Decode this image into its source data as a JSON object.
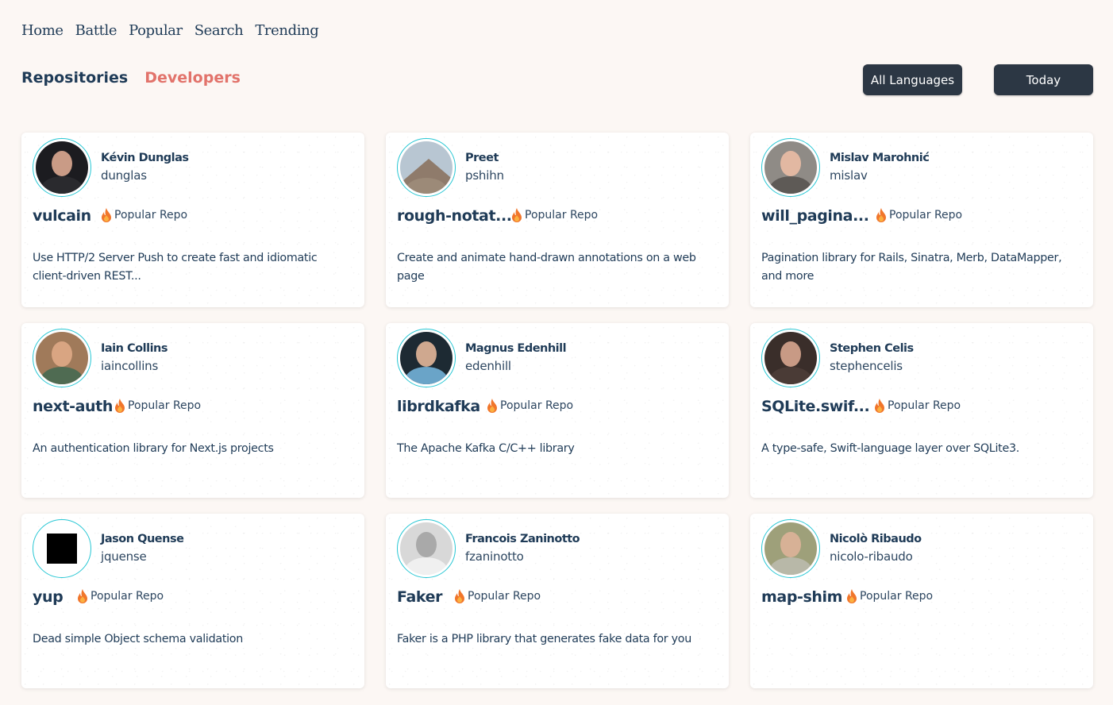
{
  "nav": {
    "home": "Home",
    "battle": "Battle",
    "popular": "Popular",
    "search": "Search",
    "trending": "Trending"
  },
  "tabs": {
    "repositories": "Repositories",
    "developers": "Developers"
  },
  "filters": {
    "language": "All Languages",
    "period": "Today"
  },
  "badge_label": "Popular Repo",
  "colors": {
    "background": "#fcf7f4",
    "text": "#1f3b57",
    "active_tab": "#e2736b",
    "button": "#2c3744",
    "avatar_ring": "#28c7d4",
    "fire": "#f1762b"
  },
  "developers": [
    {
      "name": "Kévin Dunglas",
      "username": "dunglas",
      "repo": "vulcain",
      "description": "Use HTTP/2 Server Push to create fast and idiomatic client-driven REST..."
    },
    {
      "name": "Preet",
      "username": "pshihn",
      "repo": "rough-notat...",
      "description": "Create and animate hand-drawn annotations on a web page"
    },
    {
      "name": "Mislav Marohnić",
      "username": "mislav",
      "repo": "will_pagina...",
      "description": "Pagination library for Rails, Sinatra, Merb, DataMapper, and more"
    },
    {
      "name": "Iain Collins",
      "username": "iaincollins",
      "repo": "next-auth",
      "description": "An authentication library for Next.js projects"
    },
    {
      "name": "Magnus Edenhill",
      "username": "edenhill",
      "repo": "librdkafka",
      "description": "The Apache Kafka C/C++ library"
    },
    {
      "name": "Stephen Celis",
      "username": "stephencelis",
      "repo": "SQLite.swif...",
      "description": "A type-safe, Swift-language layer over SQLite3."
    },
    {
      "name": "Jason Quense",
      "username": "jquense",
      "repo": "yup",
      "description": "Dead simple Object schema validation"
    },
    {
      "name": "Francois Zaninotto",
      "username": "fzaninotto",
      "repo": "Faker",
      "description": "Faker is a PHP library that generates fake data for you"
    },
    {
      "name": "Nicolò Ribaudo",
      "username": "nicolo-ribaudo",
      "repo": "map-shim",
      "description": ""
    }
  ]
}
